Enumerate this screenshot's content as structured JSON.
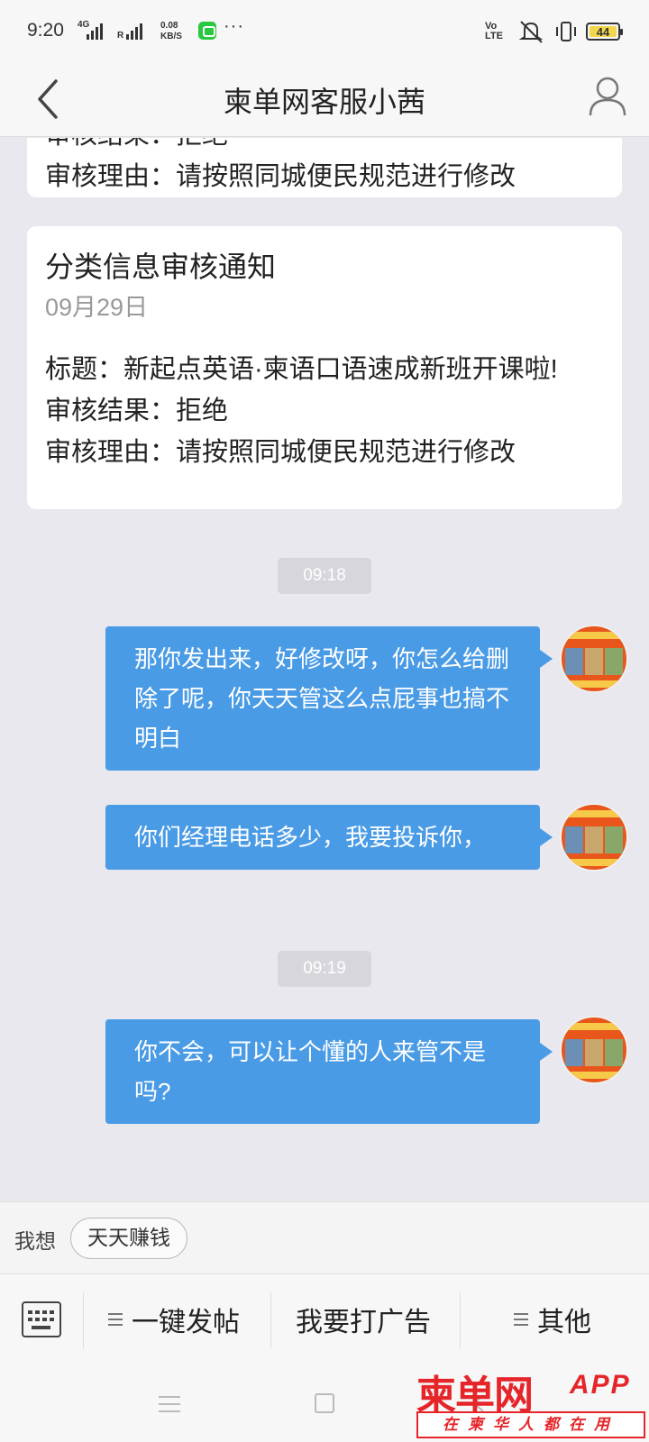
{
  "status_bar": {
    "time": "9:20",
    "network": "4G",
    "roaming": "R",
    "speed_value": "0.08",
    "speed_unit": "KB/S",
    "more": "···",
    "volte": "Vo LTE",
    "battery": "44"
  },
  "header": {
    "title": "柬单网客服小茜"
  },
  "cards": [
    {
      "result_label": "审核结果：",
      "result_value": "拒绝",
      "reason_label": "审核理由：",
      "reason_value": "请按照同城便民规范进行修改"
    },
    {
      "title": "分类信息审核通知",
      "date": "09月29日",
      "subject_label": "标题：",
      "subject_value": "新起点英语·柬语口语速成新班开课啦!",
      "result_label": "审核结果：",
      "result_value": "拒绝",
      "reason_label": "审核理由：",
      "reason_value": "请按照同城便民规范进行修改"
    }
  ],
  "messages": {
    "time1": "09:18",
    "msg1": "那你发出来，好修改呀，你怎么给删除了呢，你天天管这么点屁事也搞不明白",
    "msg2": "你们经理电话多少，我要投诉你，",
    "time2": "09:19",
    "msg3": "你不会，可以让个懂的人来管不是吗?"
  },
  "suggestion": {
    "label": "我想",
    "chip": "天天赚钱"
  },
  "menu": {
    "item1": "一键发帖",
    "item2": "我要打广告",
    "item3": "其他"
  },
  "watermark": {
    "logo": "柬单网",
    "app": "APP",
    "slogan": "在柬华人都在用"
  },
  "colors": {
    "bubble": "#4a9be6",
    "background": "#e8e8ee",
    "brand_red": "#e5252a"
  }
}
